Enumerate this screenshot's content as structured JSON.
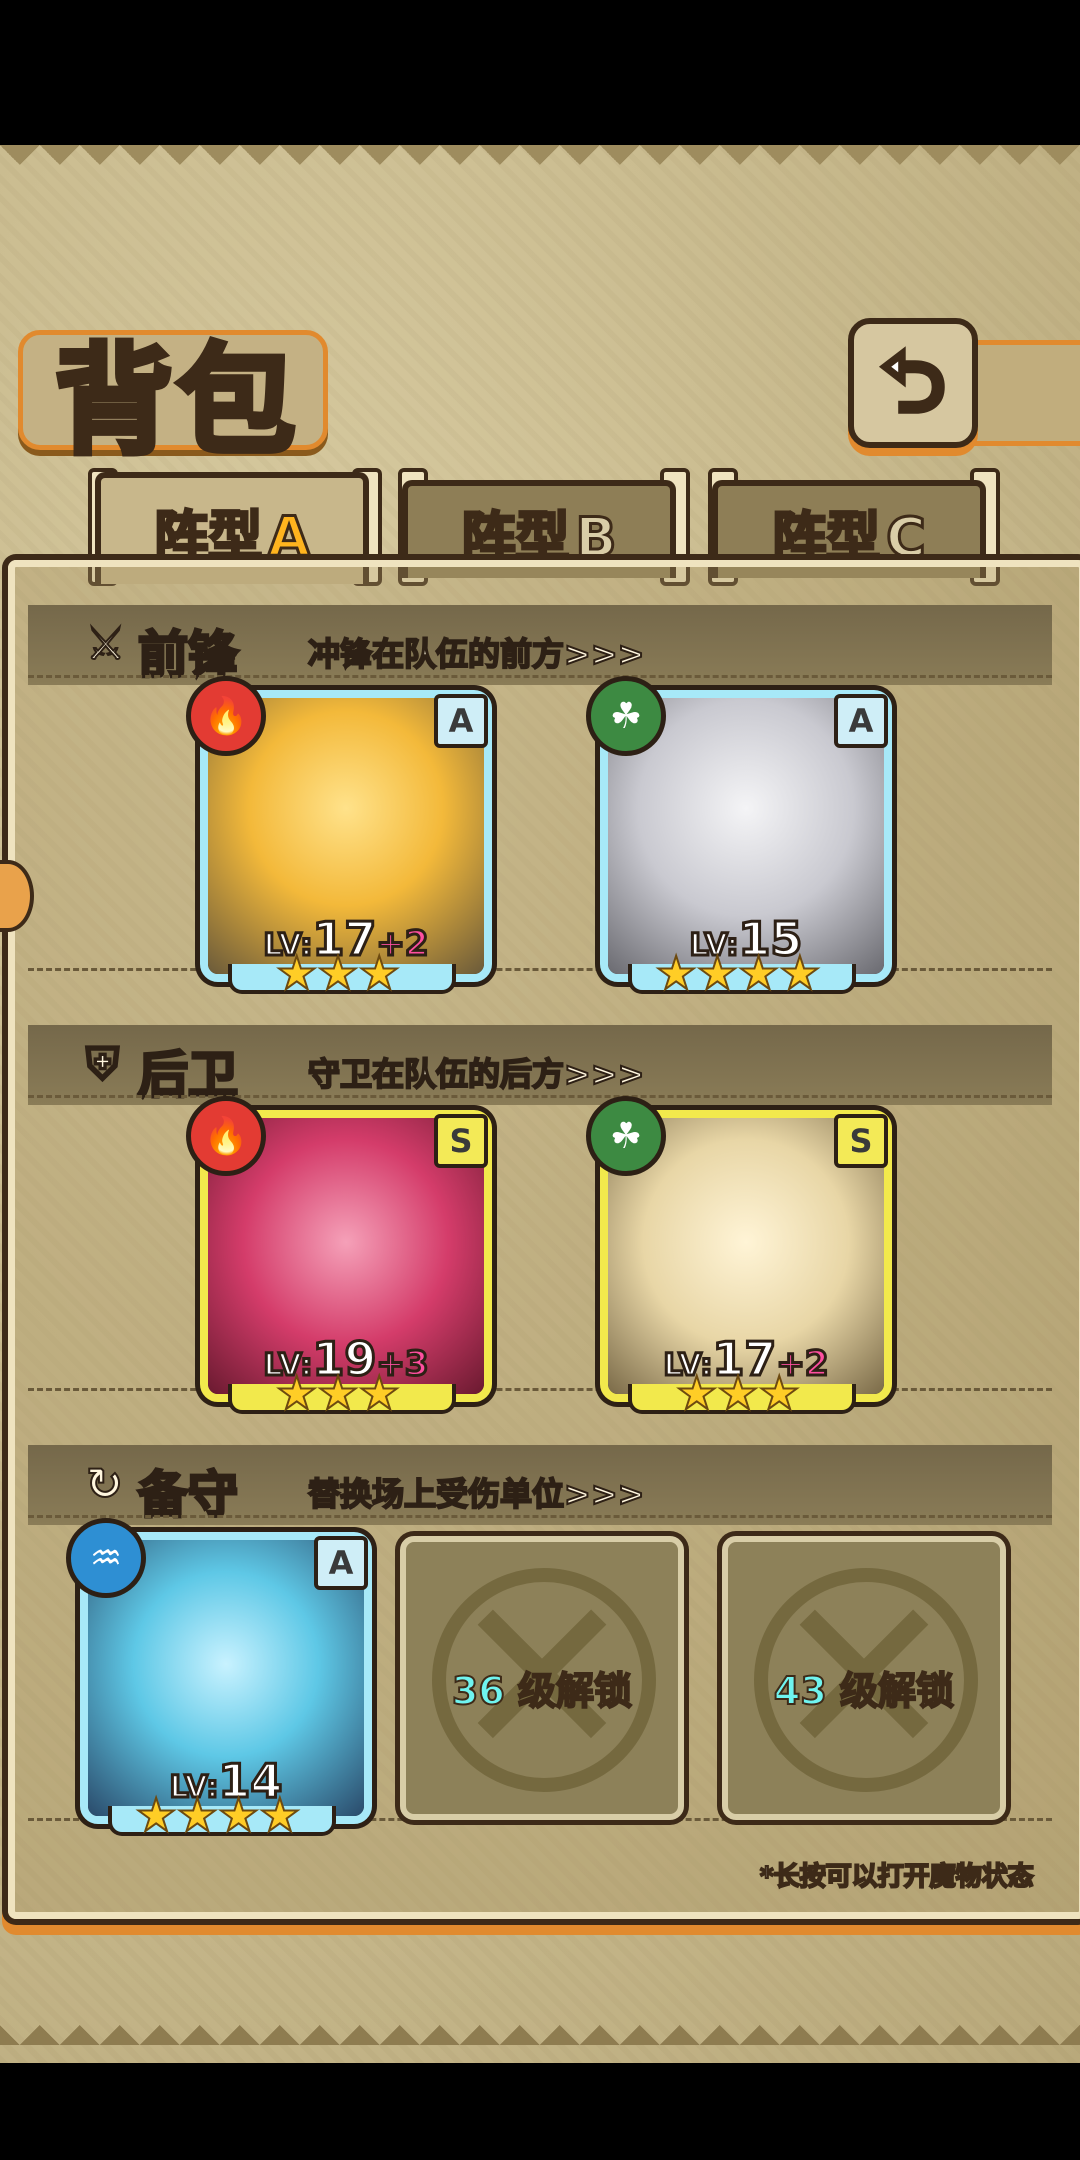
{
  "header": {
    "title": "背包"
  },
  "tabs": [
    {
      "prefix": "阵型",
      "letter": "A",
      "active": true
    },
    {
      "prefix": "阵型",
      "letter": "B",
      "active": false
    },
    {
      "prefix": "阵型",
      "letter": "C",
      "active": false
    }
  ],
  "sections": {
    "front": {
      "label": "前锋",
      "desc": "冲锋在队伍的前方>>>"
    },
    "back": {
      "label": "后卫",
      "desc": "守卫在队伍的后方>>>"
    },
    "reserve": {
      "label": "备守",
      "desc": "替换场上受伤单位>>>"
    }
  },
  "units": [
    {
      "slot": "front-1",
      "rank": "A",
      "element": "fire",
      "level_label": "LV:",
      "level": "17",
      "plus": "+2",
      "stars": 3,
      "frame": "blue"
    },
    {
      "slot": "front-2",
      "rank": "A",
      "element": "leaf",
      "level_label": "LV:",
      "level": "15",
      "plus": "",
      "stars": 4,
      "frame": "blue"
    },
    {
      "slot": "back-1",
      "rank": "S",
      "element": "fire",
      "level_label": "LV:",
      "level": "19",
      "plus": "+3",
      "stars": 3,
      "frame": "gold"
    },
    {
      "slot": "back-2",
      "rank": "S",
      "element": "leaf",
      "level_label": "LV:",
      "level": "17",
      "plus": "+2",
      "stars": 3,
      "frame": "gold"
    },
    {
      "slot": "reserve-1",
      "rank": "A",
      "element": "water",
      "level_label": "LV:",
      "level": "14",
      "plus": "",
      "stars": 4,
      "frame": "blue"
    }
  ],
  "locked_slots": [
    {
      "level": "36",
      "text": "级解锁"
    },
    {
      "level": "43",
      "text": "级解锁"
    }
  ],
  "hint": "*长按可以打开魔物状态",
  "icons": {
    "back": "back-arrow-icon",
    "fire": "fire-icon",
    "leaf": "leaf-icon",
    "water": "water-icon",
    "front": "sword-icon",
    "back_section": "shield-icon",
    "reserve": "swap-icon"
  },
  "colors": {
    "accent": "#e18a2e",
    "outline": "#3d2a18",
    "parchment": "#cbbd91",
    "tab_letter": "#ffb41e",
    "plus_level": "#ff4fa0",
    "unlock_number": "#6ff4f0"
  }
}
